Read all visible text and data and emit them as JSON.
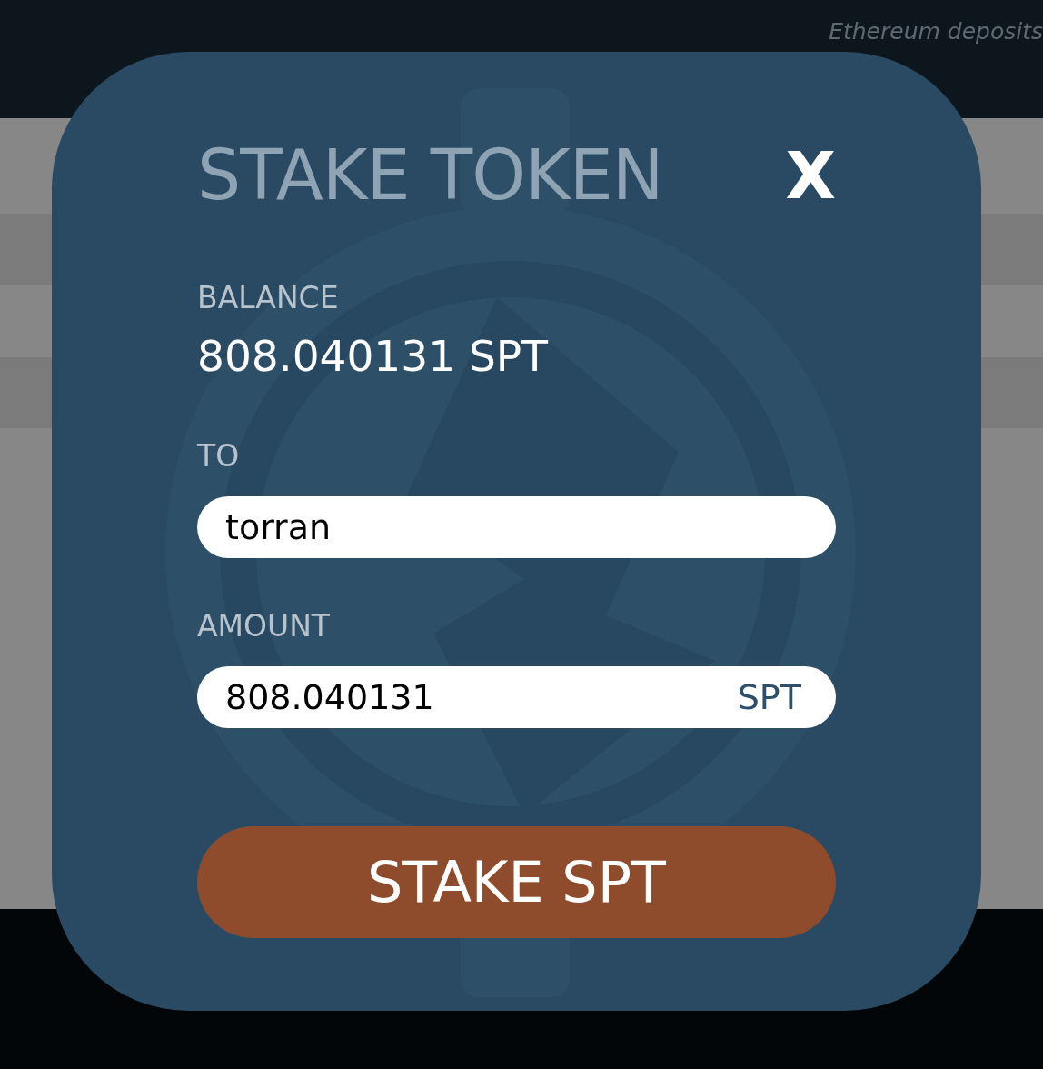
{
  "background": {
    "note": "Ethereum deposits"
  },
  "modal": {
    "title": "STAKE TOKEN",
    "close": "X",
    "balance": {
      "label": "BALANCE",
      "value": "808.040131 SPT"
    },
    "to": {
      "label": "TO",
      "value": "torran"
    },
    "amount": {
      "label": "AMOUNT",
      "value": "808.040131",
      "unit": "SPT"
    },
    "submit": "STAKE SPT"
  }
}
